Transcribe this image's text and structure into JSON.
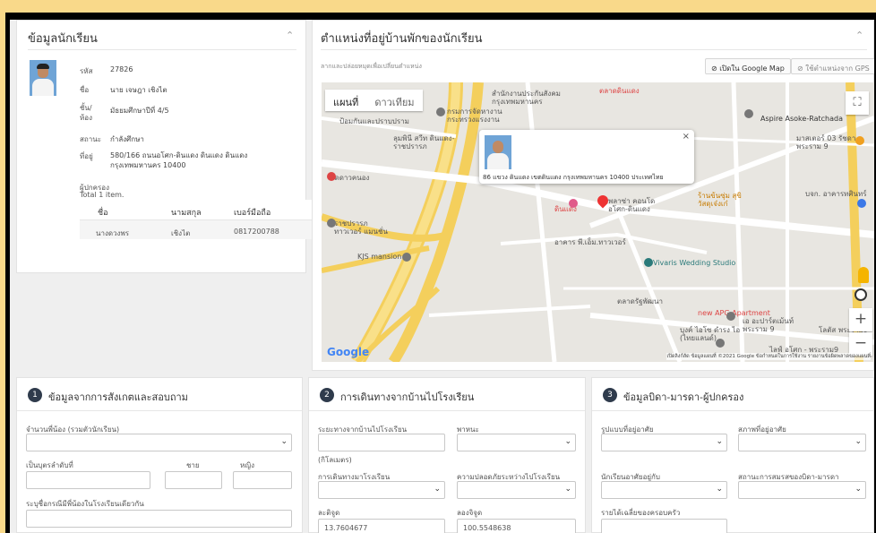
{
  "student": {
    "title": "ข้อมูลนักเรียน",
    "fields": [
      {
        "label": "รหัส",
        "value": "27826"
      },
      {
        "label": "ชื่อ",
        "value": "นาย เจษฎา เชิงไต"
      },
      {
        "label": "ชั้น/ห้อง",
        "value": "มัธยมศึกษาปีที่ 4/5"
      },
      {
        "label": "สถานะ",
        "value": "กำลังศึกษา"
      },
      {
        "label": "ที่อยู่",
        "value": "580/166 ถนนอโศก-ดินแดง ดินแดง ดินแดง กรุงเทพมหานคร 10400"
      }
    ],
    "guardian_label": "ผู้ปกครอง",
    "total_label": "Total 1 item.",
    "table_headers": [
      "ชื่อ",
      "นามสกุล",
      "เบอร์มือถือ"
    ],
    "table_rows": [
      [
        "นางดวงพร",
        "เชิงไต",
        "0817200788"
      ]
    ]
  },
  "location": {
    "title": "ตำแหน่งที่อยู่บ้านพักของนักเรียน",
    "hint": "ลากและปล่อยหมุดเพื่อเปลี่ยนตำแหน่ง",
    "open_google_map": "เปิดใน Google Map",
    "use_gps": "ใช้ตำแหน่งจาก GPS"
  },
  "map": {
    "type_map": "แผนที่",
    "type_satellite": "ดาวเทียม",
    "popup_text": "86 แขวง ดินแดง เขตดินแดง กรุงเทพมหานคร 10400 ประเทศไทย",
    "google": "Google",
    "footer": "เปิดลิงก์ลัด  ข้อมูลแผนที่ ©2021 Google  ข้อกำหนดในการใช้งาน  รายงานข้อผิดพลาดของแผนที่",
    "places": [
      "ตลาดดินแดง",
      "สำนักงานประกันสังคมกรุงเทพมหานคร",
      "กรมการจัดหางาน กระทรวงแรงงาน",
      "ป้อมกันและปราบปราม",
      "Aspire Asoke-Ratchada",
      "มาสเตอร์ 03 รัชดา-พระราม 9",
      "ลุมพินี สวีท ดินแดง-ราชปรารภ",
      "วัดดาวคนอง",
      "ราชปรารภ ทาวเวอร์ แมนชั่น",
      "ดินแดง",
      "พลาซ่า คอนโด อโศก-ดินแดง",
      "ร้านข้นซุ่ม สุขิวัสดุเจ๋งเก๋",
      "บจก. อาคารทศินทร์",
      "อาคาร พี.เอ็ม.ทาวเวอร์",
      "KJS mansion",
      "Vivaris Wedding Studio",
      "new APG Apartment",
      "เอ อะปาร์ตเม้นท์ พระราม 9",
      "ตลาดรัฐพัฒนา",
      "บุงค์ ไอโซ ดำรง ไอ (ไทยแลนด์)",
      "ไลฟ์ อโศก - พระราม9",
      "โลตัส พระราม9"
    ]
  },
  "section1": {
    "number": "1",
    "title": "ข้อมูลจากการสังเกตและสอบถาม",
    "siblings_label": "จำนวนพี่น้อง (รวมตัวนักเรียน)",
    "child_order_label": "เป็นบุตรลำดับที่",
    "male_label": "ชาย",
    "female_label": "หญิง",
    "same_school_label": "ระบุชื่อกรณีมีพี่น้องในโรงเรียนเดียวกัน"
  },
  "section2": {
    "number": "2",
    "title": "การเดินทางจากบ้านไปโรงเรียน",
    "distance_label": "ระยะทางจากบ้านไปโรงเรียน",
    "vehicle_label": "พาหนะ",
    "km_label": "(กิโลเมตร)",
    "travel_label": "การเดินทางมาโรงเรียน",
    "safety_label": "ความปลอดภัยระหว่างไปโรงเรียน",
    "lat_label": "ละติจูด",
    "lng_label": "ลองจิจูด",
    "lat_value": "13.7604677",
    "lng_value": "100.5548638"
  },
  "section3": {
    "number": "3",
    "title": "ข้อมูลบิดา-มารดา-ผู้ปกครอง",
    "residence_type_label": "รูปแบบที่อยู่อาศัย",
    "residence_status_label": "สภาพที่อยู่อาศัย",
    "lives_with_label": "นักเรียนอาศัยอยู่กับ",
    "parent_status_label": "สถานะการสมรสของบิดา-มารดา",
    "income_label": "รายได้เฉลี่ยของครอบครัว"
  }
}
